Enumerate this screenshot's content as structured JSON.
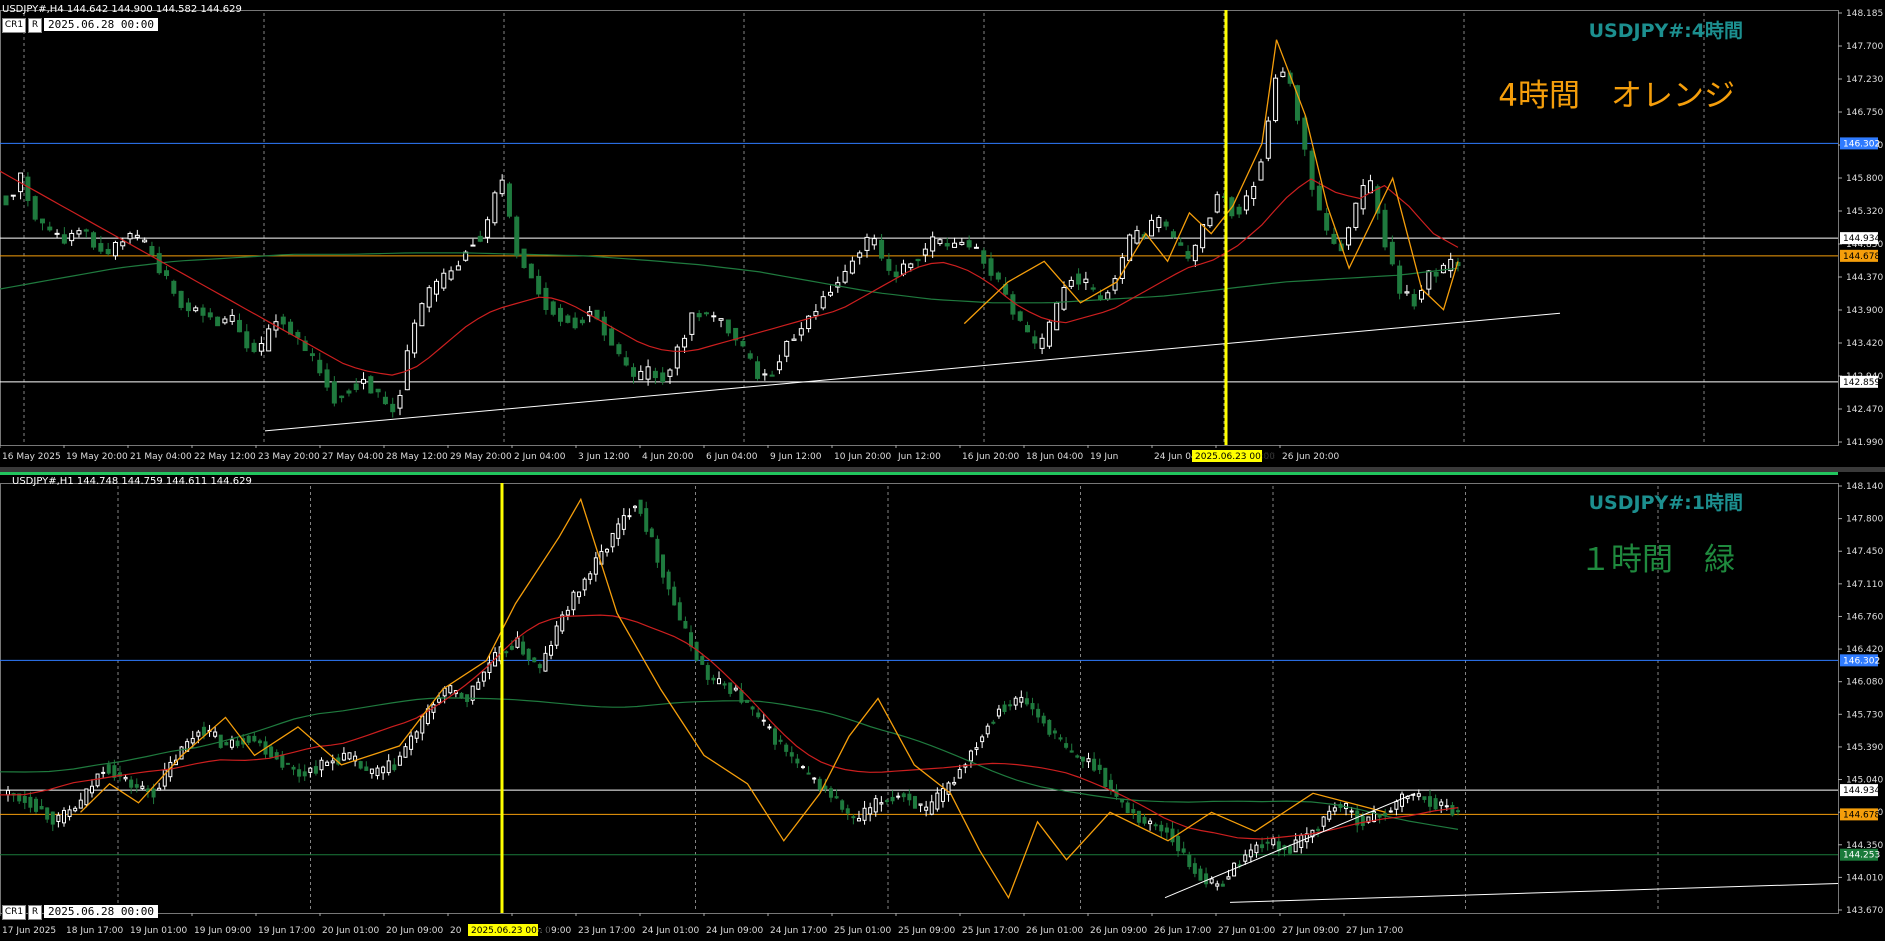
{
  "colors": {
    "bg": "#000000",
    "bull_candle": "#ffffff",
    "bear_candle": "#1f7a3e",
    "ma_fast": "#cc1f1f",
    "ma_slow": "#1f7a3e",
    "zigzag": "#f59e0b",
    "hline_blue": "#2f7bff",
    "hline_white": "#ffffff",
    "hline_orange": "#f59e0b",
    "vline_yellow": "#ffff00",
    "trendline": "#ffffff",
    "watermark_teal": "#1c8f8f",
    "watermark_orange": "#f59e0b",
    "watermark_green": "#1f8a3e"
  },
  "top": {
    "info": "USDJPY#,H4  144.642 144.900 144.582 144.629",
    "button_cr1": "CR1",
    "button_r": "R",
    "date_box": "2025.06.28 00:00",
    "watermark_symbol": "USDJPY#:4時間",
    "watermark_label": "4時間　オレンジ",
    "cursor_label": "2025.06.23 00:00",
    "time_labels": [
      "16 May 2025",
      "19 May 20:00",
      "21 May 04:00",
      "22 May 12:00",
      "23 May 20:00",
      "27 May 04:00",
      "28 May 12:00",
      "29 May 20:00",
      "2 Jun 04:00",
      "3 Jun 12:00",
      "4 Jun 20:00",
      "6 Jun 04:00",
      "9 Jun 12:00",
      "10 Jun 20:00",
      "Jun 12:00",
      "16 Jun 20:00",
      "18 Jun 04:00",
      "19 Jun",
      "24 Jun 04:00",
      "25 Jun 12:00",
      "26 Jun 20:00"
    ],
    "price_ticks": [
      "148.185",
      "147.700",
      "147.230",
      "146.750",
      "146.270",
      "145.800",
      "145.320",
      "144.850",
      "144.370",
      "143.900",
      "143.420",
      "142.940",
      "142.470",
      "141.990"
    ],
    "level_labels": {
      "blue": "146.302",
      "white_upper": "144.934",
      "orange": "144.678",
      "white_lower": "142.859",
      "hidden": "144.656"
    }
  },
  "bottom": {
    "info": "USDJPY#,H1  144.748 144.759 144.611 144.629",
    "button_cr1": "CR1",
    "button_r": "R",
    "date_box": "2025.06.28 00:00",
    "watermark_symbol": "USDJPY#:1時間",
    "watermark_label": "１時間　緑",
    "cursor_label": "2025.06.23 00:00",
    "time_labels": [
      "17 Jun 2025",
      "18 Jun 17:00",
      "19 Jun 01:00",
      "19 Jun 09:00",
      "19 Jun 17:00",
      "20 Jun 01:00",
      "20 Jun 09:00",
      "20",
      "23 Jun 09:00",
      "23 Jun 17:00",
      "24 Jun 01:00",
      "24 Jun 09:00",
      "24 Jun 17:00",
      "25 Jun 01:00",
      "25 Jun 09:00",
      "25 Jun 17:00",
      "26 Jun 01:00",
      "26 Jun 09:00",
      "26 Jun 17:00",
      "27 Jun 01:00",
      "27 Jun 09:00",
      "27 Jun 17:00"
    ],
    "price_ticks": [
      "148.140",
      "147.800",
      "147.450",
      "147.110",
      "146.760",
      "146.420",
      "146.080",
      "145.730",
      "145.390",
      "145.040",
      "144.700",
      "144.350",
      "144.010",
      "143.670"
    ],
    "level_labels": {
      "blue": "146.302",
      "white_upper": "144.934",
      "orange": "144.678",
      "green": "144.253",
      "hidden": "144.629"
    }
  },
  "chart_data": [
    {
      "type": "candlestick",
      "title": "USDJPY#,H4",
      "ylim": [
        141.99,
        148.185
      ],
      "levels": {
        "blue": 146.302,
        "white_upper": 144.934,
        "orange": 144.678,
        "white_lower": 142.859
      },
      "close_series": [
        145.5,
        145.8,
        145.2,
        145.0,
        144.9,
        145.1,
        144.8,
        144.7,
        145.0,
        144.9,
        144.6,
        144.2,
        143.9,
        143.9,
        143.7,
        143.8,
        143.4,
        143.3,
        143.8,
        143.6,
        143.3,
        143.0,
        142.6,
        142.8,
        142.9,
        142.6,
        142.4,
        143.5,
        144.1,
        144.3,
        144.5,
        144.9,
        145.0,
        145.9,
        144.8,
        144.4,
        144.0,
        143.8,
        143.7,
        143.9,
        143.6,
        143.2,
        142.9,
        143.0,
        142.9,
        143.4,
        143.9,
        143.8,
        143.7,
        143.4,
        143.0,
        142.9,
        143.4,
        143.6,
        143.9,
        144.2,
        144.4,
        144.8,
        144.9,
        144.4,
        144.5,
        144.7,
        144.9,
        144.8,
        144.9,
        144.7,
        144.4,
        144.0,
        143.6,
        143.3,
        143.8,
        144.4,
        144.3,
        144.0,
        144.3,
        144.9,
        145.0,
        145.2,
        144.9,
        144.6,
        145.1,
        145.6,
        145.3,
        145.5,
        146.2,
        147.5,
        147.0,
        145.9,
        145.1,
        144.7,
        145.3,
        145.8,
        145.0,
        144.2,
        144.0,
        144.4,
        144.5,
        144.6
      ],
      "ma_fast": [
        145.9,
        145.7,
        145.5,
        145.3,
        145.1,
        144.9,
        144.7,
        144.5,
        144.3,
        144.1,
        143.9,
        143.7,
        143.5,
        143.3,
        143.1,
        143.0,
        142.95,
        143.1,
        143.4,
        143.7,
        143.9,
        144.0,
        144.1,
        144.0,
        143.8,
        143.6,
        143.4,
        143.3,
        143.3,
        143.4,
        143.5,
        143.6,
        143.7,
        143.8,
        143.9,
        144.1,
        144.3,
        144.5,
        144.6,
        144.5,
        144.3,
        144.0,
        143.8,
        143.7,
        143.8,
        143.9,
        144.1,
        144.3,
        144.5,
        144.6,
        144.8,
        145.1,
        145.5,
        145.8,
        145.6,
        145.5,
        145.7,
        145.4,
        145.0,
        144.8
      ],
      "ma_slow": [
        144.2,
        144.35,
        144.5,
        144.6,
        144.65,
        144.7,
        144.7,
        144.72,
        144.72,
        144.7,
        144.68,
        144.62,
        144.55,
        144.45,
        144.3,
        144.15,
        144.05,
        144.0,
        144.0,
        144.05,
        144.1,
        144.2,
        144.3,
        144.35,
        144.4,
        144.5
      ]
    },
    {
      "type": "candlestick",
      "title": "USDJPY#,H1",
      "ylim": [
        143.67,
        148.14
      ],
      "levels": {
        "blue": 146.302,
        "white_upper": 144.934,
        "orange": 144.678,
        "green": 144.253
      },
      "close_series": [
        144.9,
        144.8,
        144.6,
        144.8,
        145.2,
        145.0,
        144.9,
        145.3,
        145.6,
        145.4,
        145.5,
        145.3,
        145.1,
        145.2,
        145.3,
        145.1,
        145.2,
        145.6,
        146.0,
        145.9,
        146.3,
        146.5,
        146.2,
        146.8,
        147.2,
        147.6,
        148.0,
        147.3,
        146.6,
        146.1,
        146.0,
        145.7,
        145.4,
        145.1,
        144.9,
        144.6,
        144.8,
        144.9,
        144.7,
        145.0,
        145.4,
        145.8,
        145.9,
        145.6,
        145.3,
        145.2,
        144.8,
        144.6,
        144.5,
        144.1,
        143.9,
        144.2,
        144.4,
        144.3,
        144.5,
        144.8,
        144.6,
        144.7,
        144.9,
        144.8,
        144.7
      ]
    }
  ]
}
